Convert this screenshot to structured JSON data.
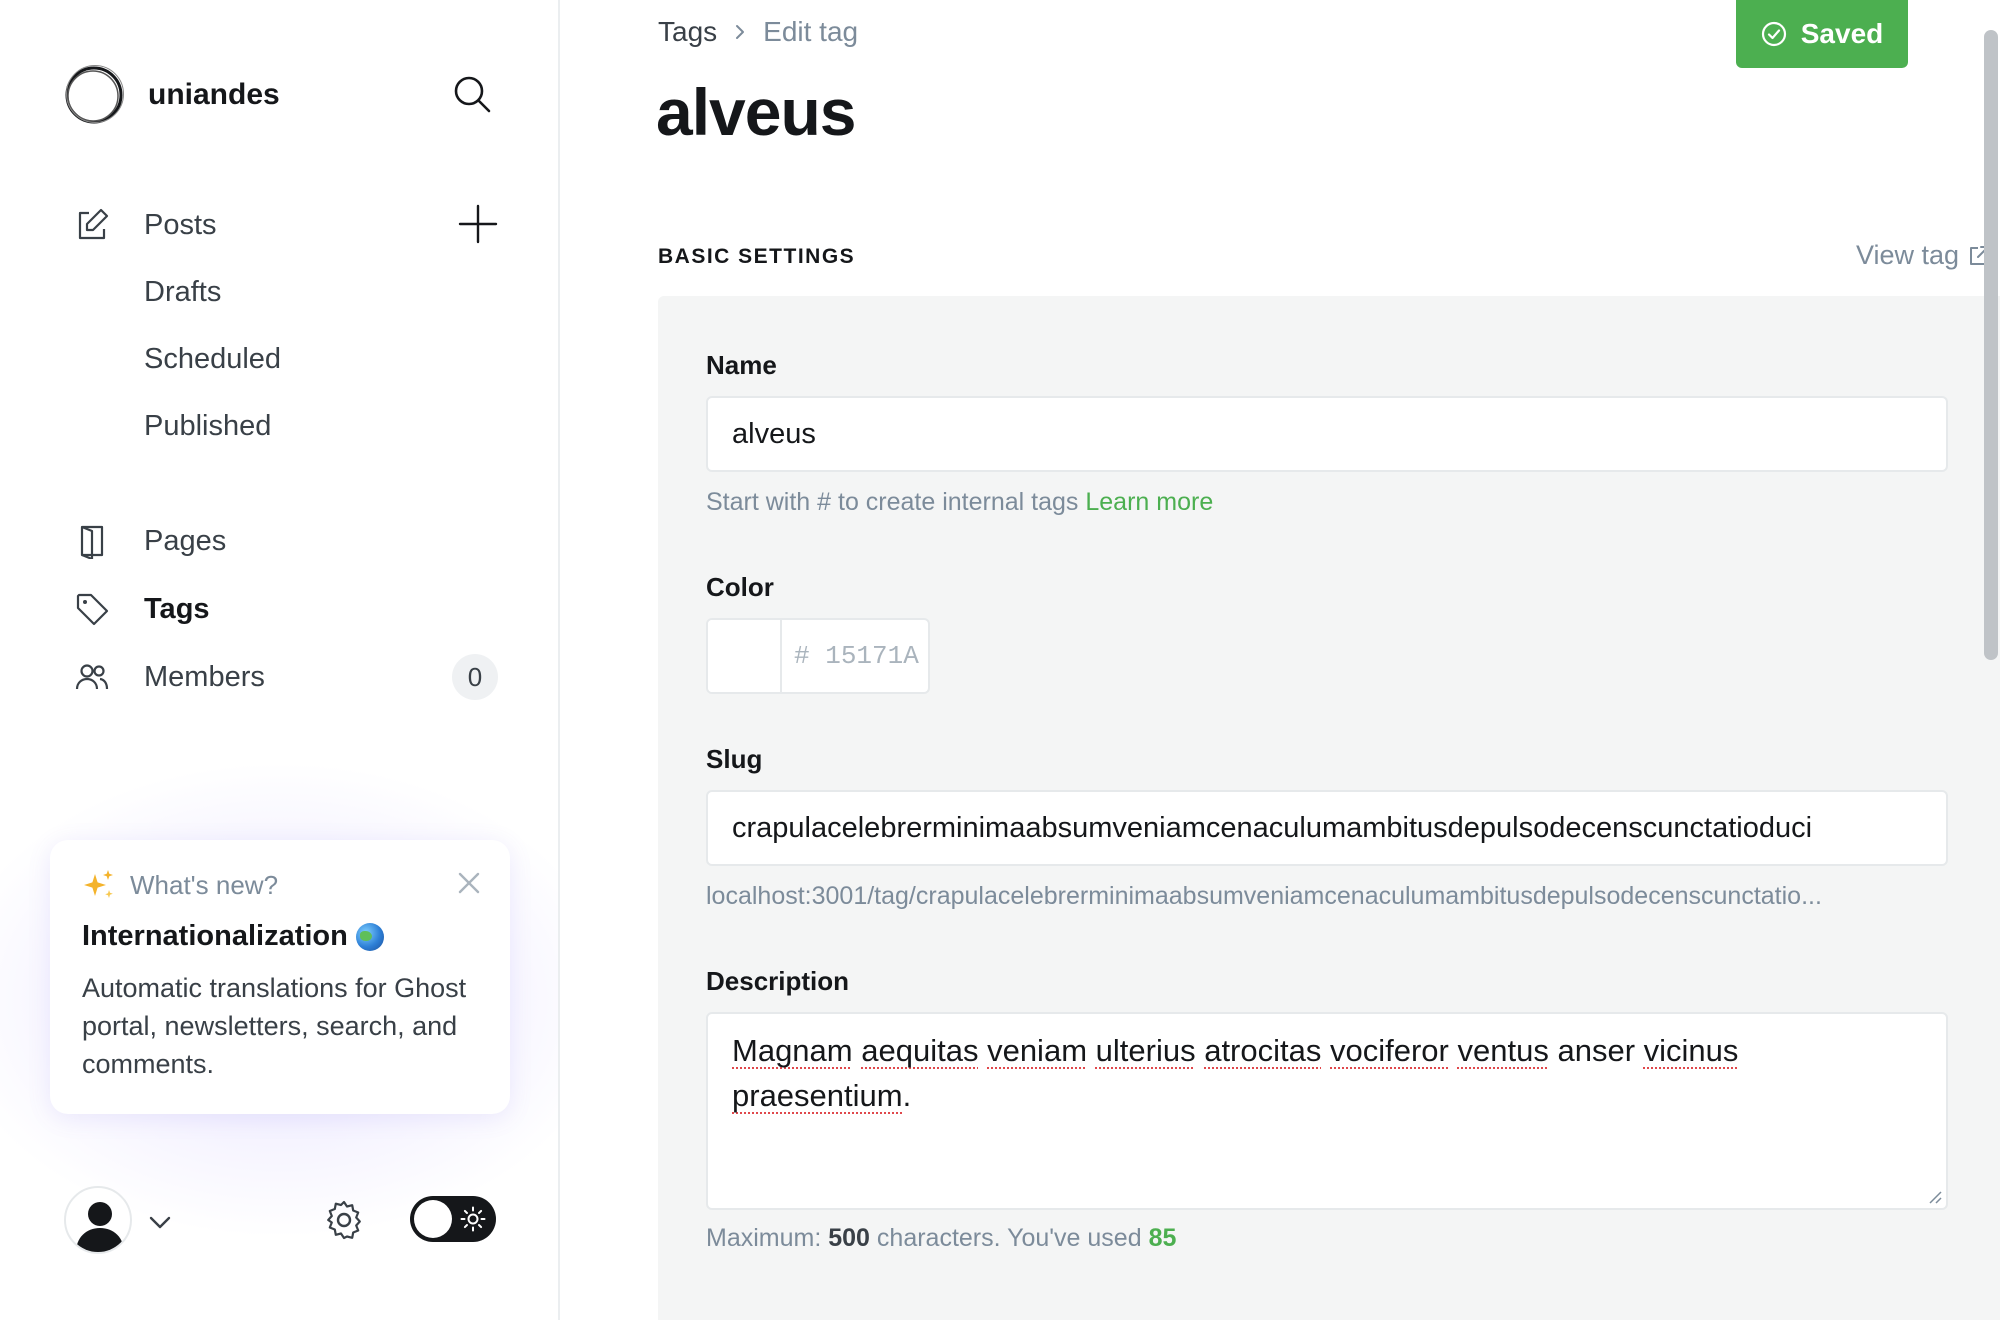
{
  "sidebar": {
    "brand": "uniandes",
    "nav": {
      "posts": "Posts",
      "drafts": "Drafts",
      "scheduled": "Scheduled",
      "published": "Published",
      "pages": "Pages",
      "tags": "Tags",
      "members": "Members",
      "members_count": "0"
    },
    "whats_new": {
      "heading": "What's new?",
      "title": "Internationalization",
      "body": "Automatic translations for Ghost portal, newsletters, search, and comments."
    }
  },
  "header": {
    "breadcrumb_parent": "Tags",
    "breadcrumb_current": "Edit tag",
    "saved_label": "Saved",
    "title": "alveus"
  },
  "section": {
    "label": "BASIC SETTINGS",
    "view_tag": "View tag"
  },
  "form": {
    "name_label": "Name",
    "name_value": "alveus",
    "name_hint": "Start with # to create internal tags",
    "name_hint_link": "Learn more",
    "color_label": "Color",
    "color_hash": "#",
    "color_value": "15171A",
    "slug_label": "Slug",
    "slug_value": "crapulacelebrerminimaabsumveniamcenaculumambitusdepulsodecenscunctatioduci",
    "slug_url": "localhost:3001/tag/crapulacelebrerminimaabsumveniamcenaculumambitusdepulsodecenscunctatio...",
    "description_label": "Description",
    "description_value": "Magnam aequitas veniam ulterius atrocitas vociferor ventus anser vicinus praesentium.",
    "desc_hint_prefix": "Maximum:",
    "desc_hint_max": "500",
    "desc_hint_mid": "characters. You've used",
    "desc_hint_used": "85"
  },
  "colors": {
    "accent_green": "#4caf50",
    "text_dark": "#15171a",
    "text_muted": "#7c8b9a",
    "panel_bg": "#f4f5f5"
  },
  "icons": [
    "brand-logo-icon",
    "search-icon",
    "edit-icon",
    "plus-icon",
    "page-icon",
    "tag-icon",
    "members-icon",
    "sparkle-icon",
    "close-icon",
    "globe-icon",
    "avatar-icon",
    "chevron-down-icon",
    "gear-icon",
    "sun-icon",
    "check-circle-icon",
    "chevron-right-icon",
    "external-link-icon"
  ]
}
